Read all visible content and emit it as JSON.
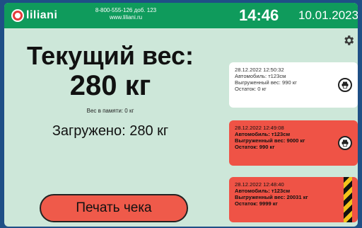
{
  "header": {
    "brand": "liliani",
    "phone": "8-800-555-126 доб. 123",
    "website": "www.liliani.ru",
    "time": "14:46",
    "date": "10.01.2023"
  },
  "main": {
    "title": "Текущий вес:",
    "current_weight": "280 кг",
    "memory_text": "Вес в памяти: 0 кг",
    "loaded_text": "Загружено: 280 кг",
    "print_button": "Печать чека"
  },
  "records": [
    {
      "datetime": "28.12.2022 12:50:32",
      "vehicle": "Автомобиль: т123см",
      "unloaded": "Выгруженный вес: 990 кг",
      "remainder": "Остаток: 0 кг",
      "status_color": "#ffffff"
    },
    {
      "datetime": "28.12.2022 12:49:08",
      "vehicle": "Автомобиль: т123см",
      "unloaded": "Выгруженный вес: 9000 кг",
      "remainder": "Остаток: 990 кг",
      "status_color": "#ef5346"
    },
    {
      "datetime": "28.12.2022 12:48:40",
      "vehicle": "Автомобиль: т123см",
      "unloaded": "Выгруженный вес: 20031 кг",
      "remainder": "Остаток: 9999 кг",
      "status_color": "#ef5346"
    }
  ],
  "icons": {
    "settings": "gear-icon",
    "print": "printer-icon",
    "hazard": "hazard-stripes-icon"
  },
  "colors": {
    "header": "#0f9b5c",
    "background": "#cde7d9",
    "accent_red": "#ef5346"
  }
}
